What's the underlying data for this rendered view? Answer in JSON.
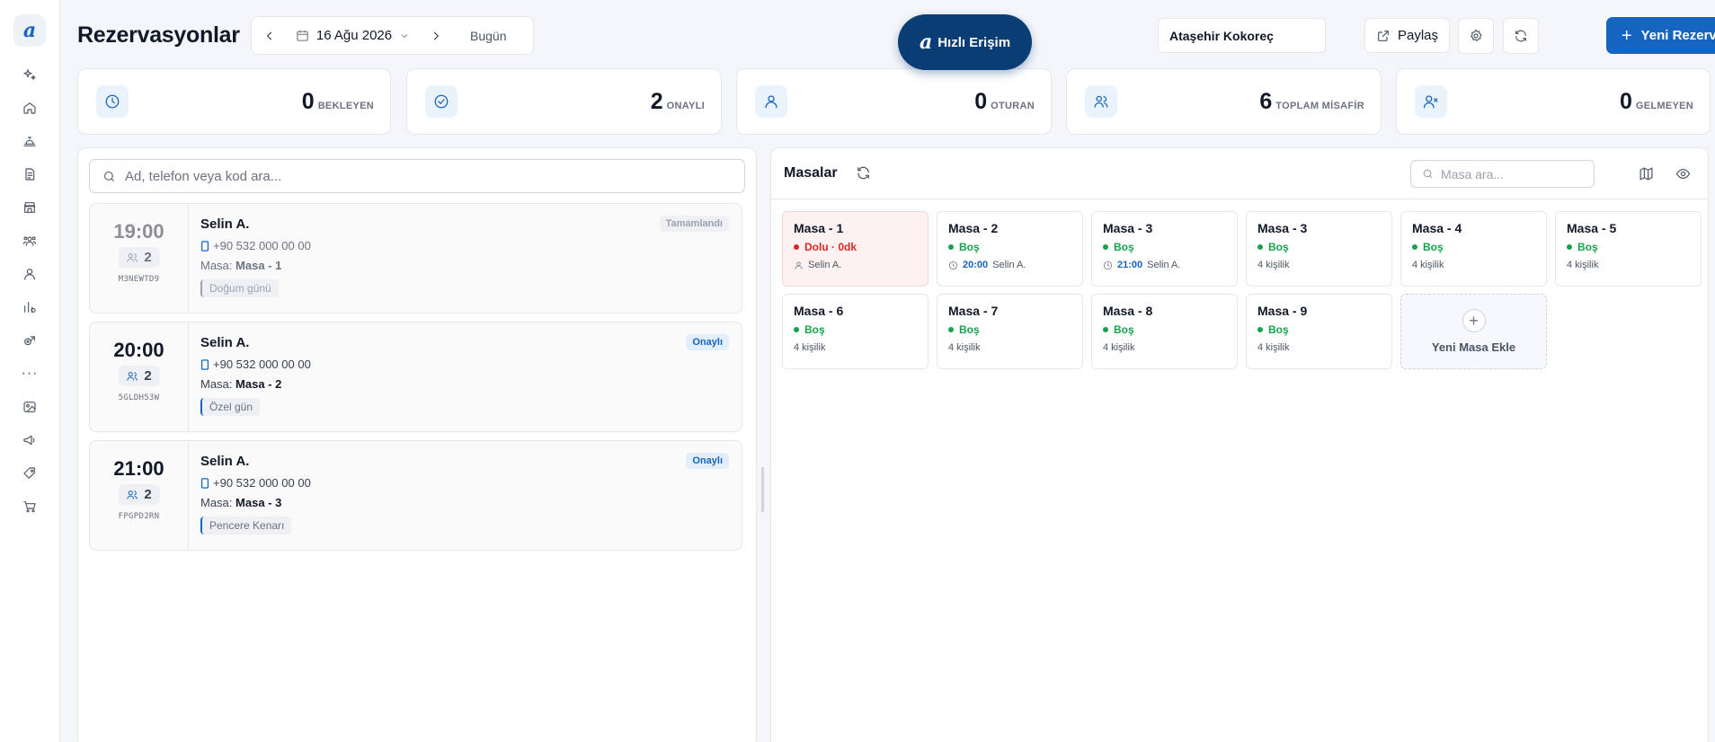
{
  "page": {
    "title": "Rezervasyonlar"
  },
  "date_nav": {
    "date": "16 Ağu 2026",
    "today_label": "Bugün"
  },
  "quick_access": {
    "logo": "a",
    "label": "Hızlı Erişim"
  },
  "sidebar": {
    "logo": "a",
    "items": [
      {
        "icon": "sparkle-icon"
      },
      {
        "icon": "home-icon"
      },
      {
        "icon": "service-bell-icon"
      },
      {
        "icon": "document-icon"
      },
      {
        "icon": "store-icon"
      },
      {
        "icon": "users-group-icon"
      },
      {
        "icon": "user-icon"
      },
      {
        "icon": "chart-icon"
      },
      {
        "icon": "settings-tags-icon"
      },
      {
        "icon": "more-icon"
      },
      {
        "icon": "image-icon"
      },
      {
        "icon": "megaphone-icon"
      },
      {
        "icon": "ticket-icon"
      },
      {
        "icon": "cart-icon"
      }
    ]
  },
  "header": {
    "branch": "Ataşehir Kokoreç",
    "share_label": "Paylaş",
    "new_reservation_label": "Yeni Rezervasyon"
  },
  "stats": [
    {
      "value": "0",
      "label": "BEKLEYEN",
      "icon": "clock-icon"
    },
    {
      "value": "2",
      "label": "ONAYLI",
      "icon": "check-circle-icon"
    },
    {
      "value": "0",
      "label": "OTURAN",
      "icon": "user-icon"
    },
    {
      "value": "6",
      "label": "TOPLAM MİSAFİR",
      "icon": "users-icon"
    },
    {
      "value": "0",
      "label": "GELMEYEN",
      "icon": "user-x-icon"
    }
  ],
  "reservations": {
    "search_placeholder": "Ad, telefon veya kod ara...",
    "items": [
      {
        "time": "19:00",
        "pax": "2",
        "code": "M3NEWTD9",
        "name": "Selin A.",
        "phone": "+90 532 000 00 00",
        "table_prefix": "Masa:",
        "table": "Masa - 1",
        "tag": "Doğum günü",
        "status": "Tamamlandı"
      },
      {
        "time": "20:00",
        "pax": "2",
        "code": "5GLDH53W",
        "name": "Selin A.",
        "phone": "+90 532 000 00 00",
        "table_prefix": "Masa:",
        "table": "Masa - 2",
        "tag": "Özel gün",
        "status": "Onaylı"
      },
      {
        "time": "21:00",
        "pax": "2",
        "code": "FPGPD2RN",
        "name": "Selin A.",
        "phone": "+90 532 000 00 00",
        "table_prefix": "Masa:",
        "table": "Masa - 3",
        "tag": "Pencere Kenarı",
        "status": "Onaylı"
      }
    ]
  },
  "tables_panel": {
    "title": "Masalar",
    "search_placeholder": "Masa ara...",
    "add_label": "Yeni Masa Ekle",
    "tables": [
      {
        "name": "Masa - 1",
        "status": "Dolu · 0dk",
        "meta_time": "",
        "meta_text": "Selin A.",
        "meta_icon": "user-icon"
      },
      {
        "name": "Masa - 2",
        "status": "Boş",
        "meta_time": "20:00",
        "meta_text": "Selin A.",
        "meta_icon": "clock-icon"
      },
      {
        "name": "Masa - 3",
        "status": "Boş",
        "meta_time": "21:00",
        "meta_text": "Selin A.",
        "meta_icon": "clock-icon"
      },
      {
        "name": "Masa - 3",
        "status": "Boş",
        "meta_time": "",
        "meta_text": "4 kişilik",
        "meta_icon": ""
      },
      {
        "name": "Masa - 4",
        "status": "Boş",
        "meta_time": "",
        "meta_text": "4 kişilik",
        "meta_icon": ""
      },
      {
        "name": "Masa - 5",
        "status": "Boş",
        "meta_time": "",
        "meta_text": "4 kişilik",
        "meta_icon": ""
      },
      {
        "name": "Masa - 6",
        "status": "Boş",
        "meta_time": "",
        "meta_text": "4 kişilik",
        "meta_icon": ""
      },
      {
        "name": "Masa - 7",
        "status": "Boş",
        "meta_time": "",
        "meta_text": "4 kişilik",
        "meta_icon": ""
      },
      {
        "name": "Masa - 8",
        "status": "Boş",
        "meta_time": "",
        "meta_text": "4 kişilik",
        "meta_icon": ""
      },
      {
        "name": "Masa - 9",
        "status": "Boş",
        "meta_time": "",
        "meta_text": "4 kişilik",
        "meta_icon": ""
      }
    ]
  },
  "colors": {
    "accent": "#1565c0",
    "quick_access_bg": "#0b3d75",
    "free": "#16a34a",
    "busy": "#dc2626"
  }
}
